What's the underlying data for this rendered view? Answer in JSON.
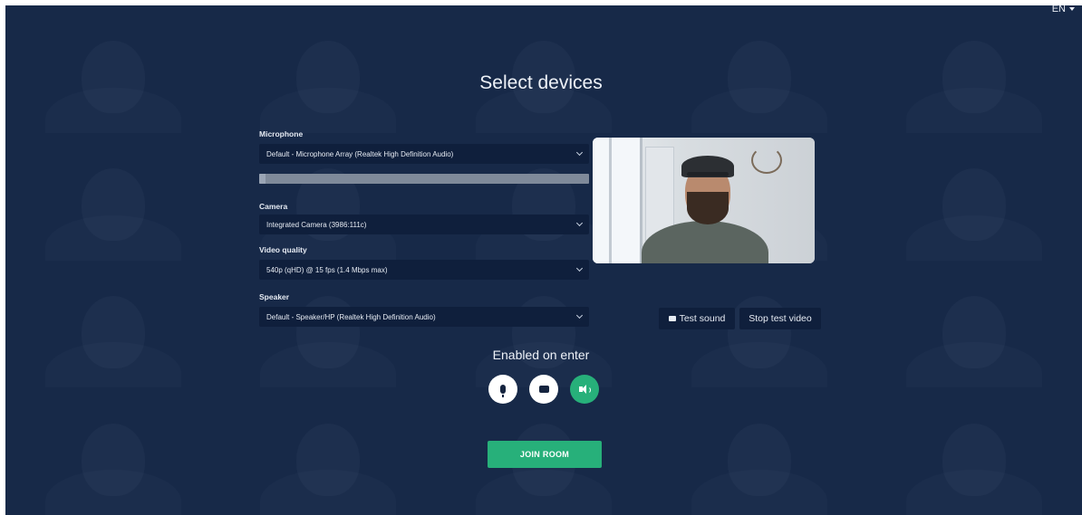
{
  "language": {
    "selected": "EN"
  },
  "page": {
    "title": "Select devices"
  },
  "devices": {
    "microphone": {
      "label": "Microphone",
      "value": "Default - Microphone Array (Realtek High Definition Audio)",
      "level": 0.02
    },
    "camera": {
      "label": "Camera",
      "value": "Integrated Camera (3986:111c)"
    },
    "video_quality": {
      "label": "Video quality",
      "value": "540p (qHD) @ 15 fps (1.4 Mbps max)"
    },
    "speaker": {
      "label": "Speaker",
      "value": "Default - Speaker/HP (Realtek High Definition Audio)"
    }
  },
  "actions": {
    "test_sound": "Test sound",
    "stop_test_video": "Stop test video"
  },
  "enabled_on_enter": {
    "title": "Enabled on enter",
    "toggles": [
      {
        "name": "microphone",
        "icon": "microphone-icon",
        "enabled": false
      },
      {
        "name": "camera",
        "icon": "camera-icon",
        "enabled": false
      },
      {
        "name": "speaker",
        "icon": "speaker-icon",
        "enabled": true
      }
    ]
  },
  "join": {
    "label": "JOIN ROOM"
  },
  "colors": {
    "accent": "#27b07a",
    "background": "#1b2d4d",
    "control": "#0f1f3c"
  }
}
